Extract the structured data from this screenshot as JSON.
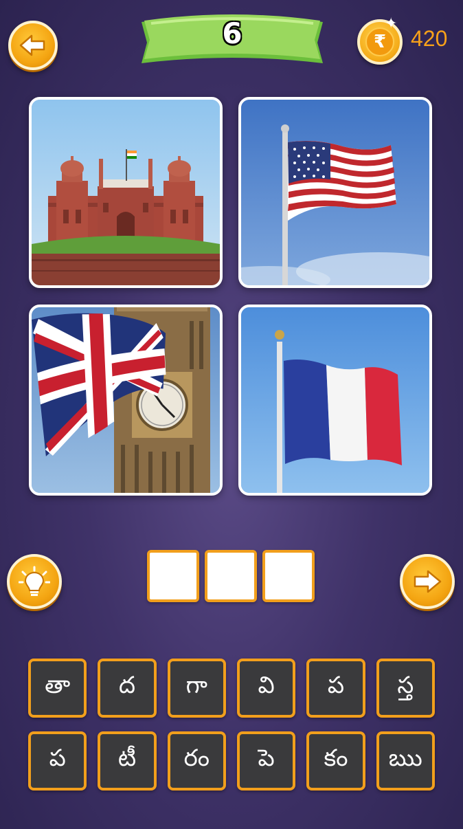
{
  "header": {
    "level": "6",
    "coins": "420",
    "currency_symbol": "₹"
  },
  "icons": {
    "back": "back-arrow-icon",
    "hint": "lightbulb-icon",
    "next": "next-arrow-icon",
    "coin": "rupee-coin-icon"
  },
  "photos": [
    {
      "name": "red-fort-with-indian-flag"
    },
    {
      "name": "american-flag"
    },
    {
      "name": "british-flag-big-ben"
    },
    {
      "name": "french-flag"
    }
  ],
  "answer": {
    "slots": [
      "",
      "",
      ""
    ]
  },
  "letters": {
    "row1": [
      "తా",
      "ద",
      "గా",
      "వి",
      "ప",
      "స్త"
    ],
    "row2": [
      "ప",
      "టీ",
      "రం",
      "పె",
      "కం",
      "ఋ"
    ]
  },
  "colors": {
    "accent": "#f29f1c",
    "banner_green": "#8ed35a",
    "tile_bg": "#3a3a3c",
    "background": "#3f3268"
  }
}
